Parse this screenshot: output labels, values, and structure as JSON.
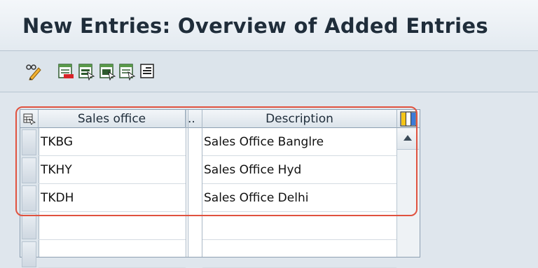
{
  "window": {
    "title": "New Entries: Overview of Added Entries"
  },
  "toolbar": {
    "buttons": [
      {
        "icon": "pencil-glasses-icon"
      },
      {
        "icon": "delete-rows-icon"
      },
      {
        "icon": "select-all-icon"
      },
      {
        "icon": "select-block-icon"
      },
      {
        "icon": "deselect-all-icon"
      },
      {
        "icon": "table-settings-icon"
      }
    ]
  },
  "table": {
    "columns": {
      "sales_office": "Sales office",
      "dots": "..",
      "description": "Description"
    },
    "rows": [
      {
        "sales_office": "TKBG",
        "description": "Sales Office Banglre"
      },
      {
        "sales_office": "TKHY",
        "description": "Sales Office Hyd"
      },
      {
        "sales_office": "TKDH",
        "description": "Sales Office Delhi"
      },
      {
        "sales_office": "",
        "description": ""
      },
      {
        "sales_office": "",
        "description": ""
      }
    ]
  },
  "colors": {
    "highlight": "#e0523f",
    "header_bg": "#dbe3ea",
    "page_bg": "#dfe6ed"
  }
}
